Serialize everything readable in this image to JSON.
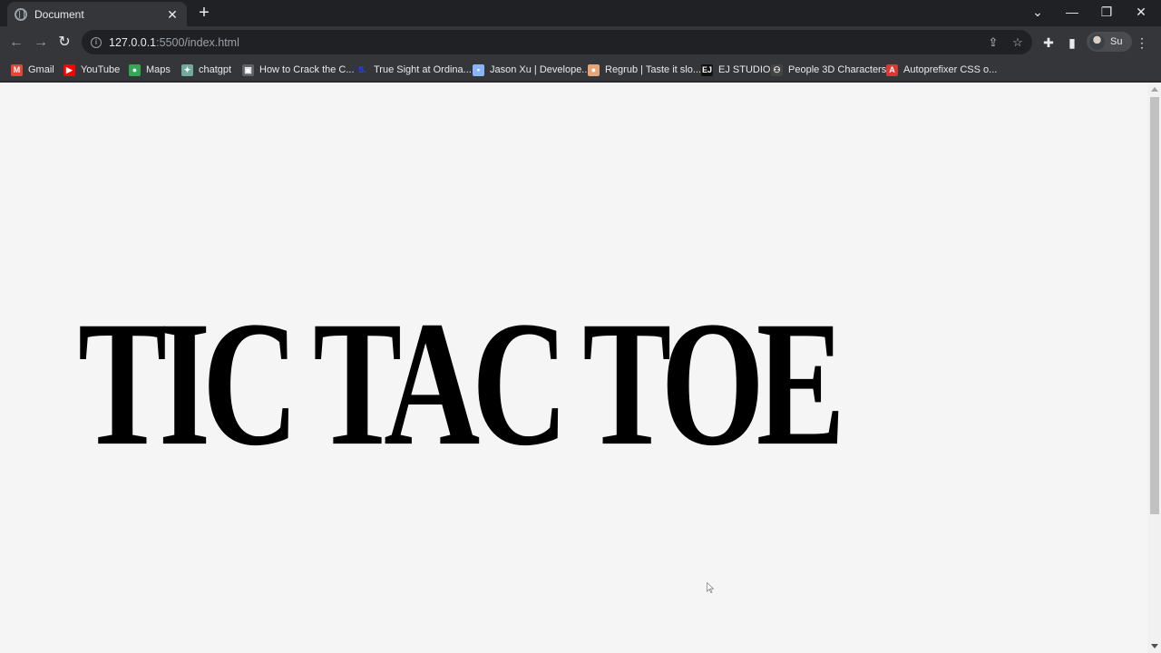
{
  "browser": {
    "tab": {
      "title": "Document",
      "close_glyph": "✕"
    },
    "new_tab_glyph": "+",
    "window_controls": {
      "dropdown": "⌄",
      "minimize": "—",
      "restore": "❐",
      "close": "✕"
    },
    "toolbar": {
      "back_glyph": "←",
      "forward_glyph": "→",
      "reload_glyph": "↻",
      "url_host": "127.0.0.1",
      "url_rest": ":5500/index.html",
      "profile_name": "Su"
    },
    "bookmarks": [
      {
        "label": "Gmail",
        "icon": "gmail-icon",
        "color": "#ea4335",
        "glyph": "M"
      },
      {
        "label": "YouTube",
        "icon": "youtube-icon",
        "color": "#ff0000",
        "glyph": "▶"
      },
      {
        "label": "Maps",
        "icon": "maps-icon",
        "color": "#34a853",
        "glyph": "●"
      },
      {
        "label": "chatgpt",
        "icon": "chatgpt-icon",
        "color": "#74aa9c",
        "glyph": "✦"
      },
      {
        "label": "How to Crack the C...",
        "icon": "page-icon",
        "color": "#5f6368",
        "glyph": "▣"
      },
      {
        "label": "True Sight at Ordina...",
        "icon": "s-icon",
        "color": "#1a4cff",
        "glyph": "S."
      },
      {
        "label": "Jason Xu | Develope...",
        "icon": "image-icon",
        "color": "#8ab4f8",
        "glyph": "▪"
      },
      {
        "label": "Regrub | Taste it slo...",
        "icon": "regrub-icon",
        "color": "#e8a57a",
        "glyph": "●"
      },
      {
        "label": "EJ STUDIO",
        "icon": "ej-icon",
        "color": "#111111",
        "glyph": "EJ"
      },
      {
        "label": "People 3D Characters",
        "icon": "people-icon",
        "color": "#444444",
        "glyph": "⚇"
      },
      {
        "label": "Autoprefixer CSS o...",
        "icon": "autoprefixer-icon",
        "color": "#dd3735",
        "glyph": "A"
      }
    ]
  },
  "page": {
    "heading": "TIC TAC TOE"
  }
}
